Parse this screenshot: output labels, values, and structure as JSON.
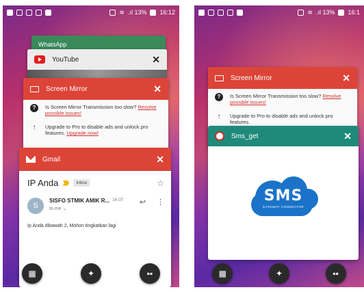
{
  "left_screen": {
    "status": {
      "signal": ".ıl 13%",
      "time": "16:12"
    },
    "cards": {
      "whatsapp": {
        "title": "WhatsApp"
      },
      "youtube": {
        "title": "YouTube"
      },
      "screen_mirror": {
        "title": "Screen Mirror",
        "row1_text": "Is Screen Mirror Transmission too slow?",
        "row1_link": "Resolve possible issues!",
        "row2_text": "Upgrade to Pro to disable ads and unlock pro features.",
        "row2_link": "Upgrade now!"
      },
      "gmail": {
        "title": "Gmail",
        "subject": "IP Anda",
        "label": "Inbox",
        "sender": "SISFO STMIK AMIK R...",
        "time": "16:07",
        "recipient": "to me",
        "avatar_letter": "S",
        "body": "Ip Anda dibawah 2, Mohon tingkatkan lagi"
      }
    }
  },
  "right_screen": {
    "status": {
      "signal": ".ıl 13%",
      "time": "16:1"
    },
    "cards": {
      "screen_mirror": {
        "title": "Screen Mirror",
        "row1_text": "Is Screen Mirror Transmission too slow?",
        "row1_link": "Resolve possible issues!",
        "row2_text": "Upgrade to Pro to disable ads and unlock pro features."
      },
      "sms_get": {
        "title": "Sms_get",
        "logo_text": "SMS",
        "logo_sub": "GATEWAY CONNECTOR"
      }
    }
  },
  "icons": {
    "nav_left": "gallery-settings-icon",
    "nav_center": "clean-icon",
    "nav_right": "apps-icon",
    "close": "close-icon"
  },
  "colors": {
    "red_header": "#dd4438",
    "teal_header": "#1f8a7a",
    "sms_blue": "#1a73c8",
    "whatsapp_green": "#3a8a5a"
  }
}
